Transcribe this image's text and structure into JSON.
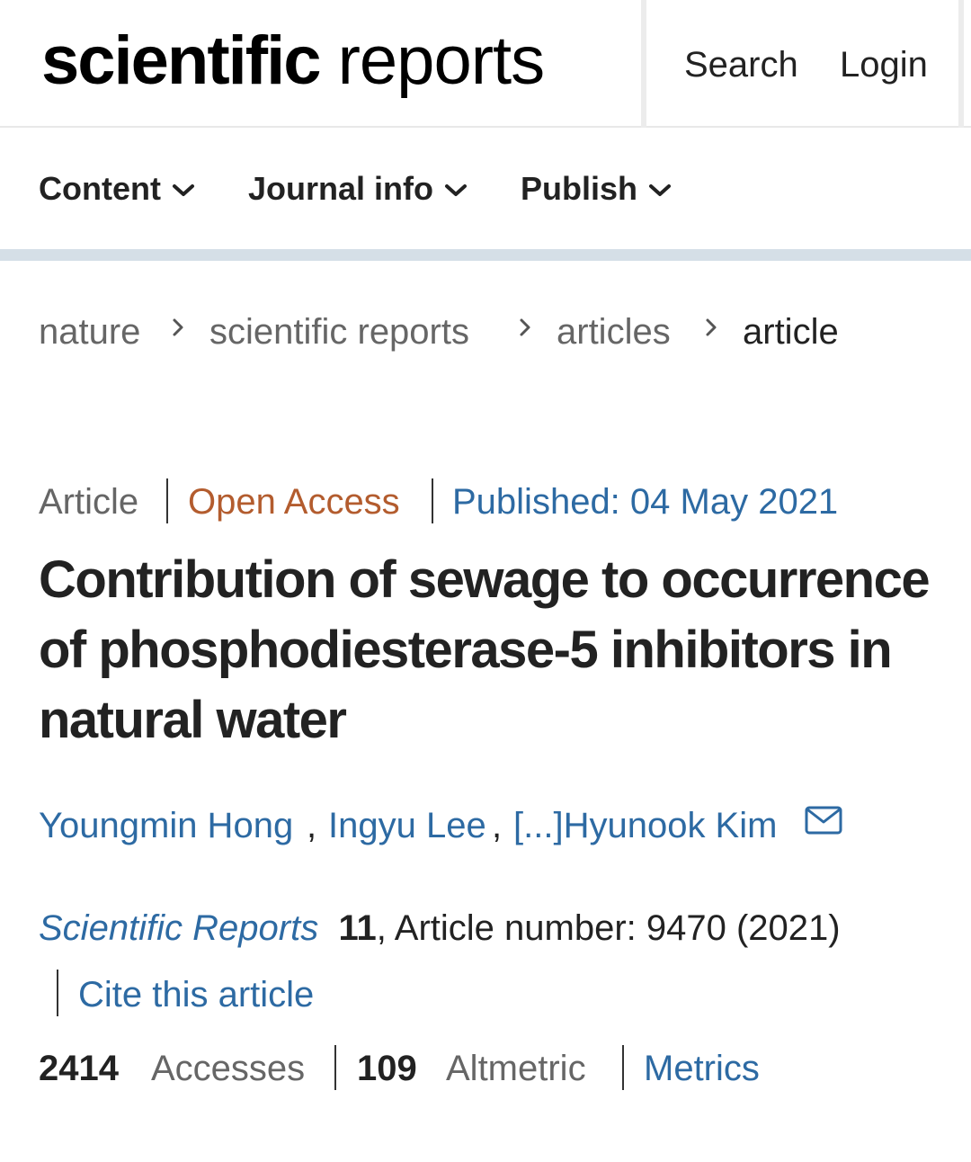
{
  "header": {
    "brand_bold": "scientific",
    "brand_light": "reports",
    "search_label": "Search",
    "login_label": "Login"
  },
  "nav": {
    "items": [
      {
        "label": "Content"
      },
      {
        "label": "Journal info"
      },
      {
        "label": "Publish"
      }
    ]
  },
  "breadcrumb": {
    "items": [
      "nature",
      "scientific reports",
      "articles",
      "article"
    ],
    "separator": "›"
  },
  "article": {
    "type": "Article",
    "access": "Open Access",
    "published": "Published: 04 May 2021",
    "title": "Contribution of sewage to occurrence of phosphodiesterase-5 inhibitors in natural water",
    "authors": [
      "Youngmin Hong",
      "Ingyu Lee",
      "[...]Hyunook Kim"
    ],
    "journal": "Scientific Reports",
    "volume": "11",
    "article_number_text": ", Article number: 9470 (2021)",
    "cite_label": "Cite this article"
  },
  "metrics": {
    "accesses_count": "2414",
    "accesses_label": "Accesses",
    "altmetric_count": "109",
    "altmetric_label": "Altmetric",
    "metrics_link": "Metrics"
  },
  "colors": {
    "link": "#2d6aa3",
    "open_access": "#b35c2e",
    "nav_bar": "#d5dfe7"
  },
  "icons": [
    "chevron-down-icon",
    "chevron-right-icon",
    "mail-icon"
  ]
}
